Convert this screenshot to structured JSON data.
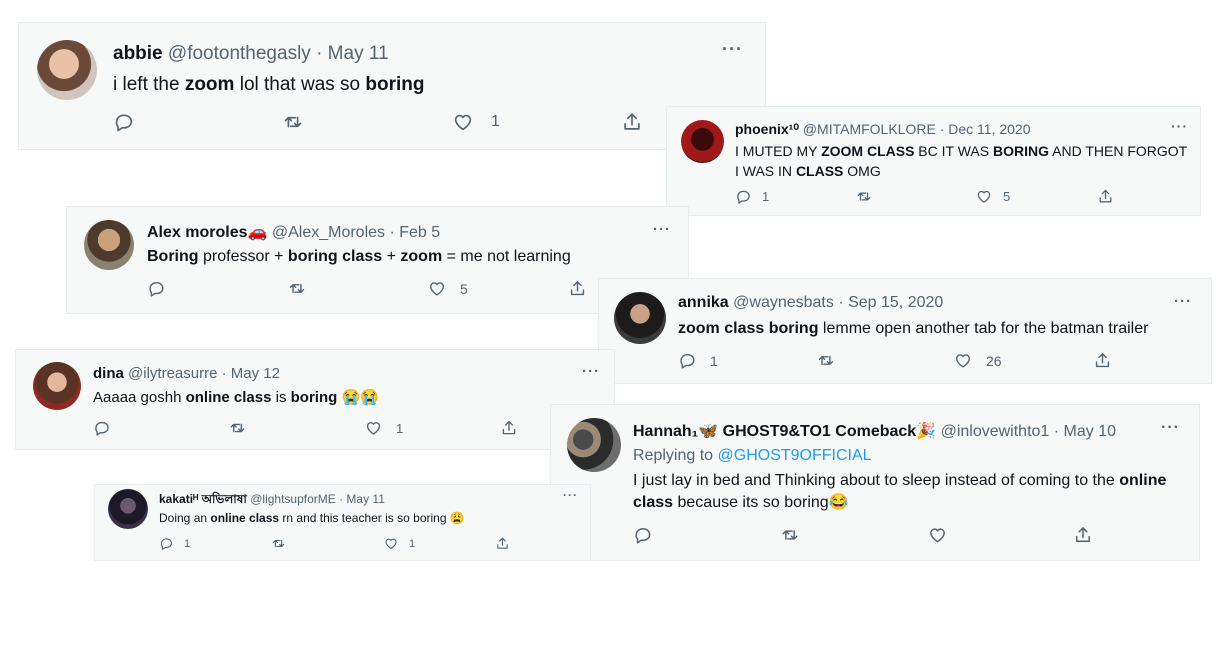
{
  "tweets": {
    "abbie": {
      "name": "abbie",
      "handle": "@footonthegasly · May 11",
      "parts": [
        "i left the ",
        "zoom",
        " lol that was so ",
        "boring"
      ],
      "likes": "1"
    },
    "phoenix": {
      "name": "phoenix¹⁰",
      "handle": "@MITAMFOLKLORE · Dec 11, 2020",
      "parts": [
        "I MUTED MY ",
        "ZOOM CLASS",
        " BC IT WAS ",
        "BORING",
        " AND THEN FORGOT I WAS IN ",
        "CLASS",
        " OMG"
      ],
      "replies": "1",
      "likes": "5"
    },
    "alex": {
      "name": "Alex moroles🚗",
      "handle": "@Alex_Moroles · Feb 5",
      "parts": [
        "Boring",
        " professor + ",
        "boring class",
        " + ",
        "zoom",
        " = me not learning"
      ],
      "likes": "5"
    },
    "annika": {
      "name": "annika",
      "handle": "@waynesbats · Sep 15, 2020",
      "parts": [
        "zoom class boring",
        " lemme open another tab for the batman trailer"
      ],
      "replies": "1",
      "likes": "26"
    },
    "dina": {
      "name": "dina",
      "handle": "@ilytreasurre · May 12",
      "parts": [
        "Aaaaa goshh ",
        "online class",
        " is ",
        "boring",
        " 😭😭"
      ],
      "likes": "1"
    },
    "hannah": {
      "name": "Hannah₁🦋 GHOST9&TO1 Comeback🎉",
      "handle": "@inlovewithto1 · May 10",
      "replying": "Replying to",
      "replying_to": "@GHOST9OFFICIAL",
      "parts": [
        "I just lay in bed and Thinking about to sleep instead of coming to the ",
        "online class",
        " because its so boring😂"
      ]
    },
    "kakati": {
      "name": "kakatiᴴ অভিলাষা",
      "handle": "@lightsupforME · May 11",
      "parts": [
        "Doing an ",
        "online class",
        " rn and this teacher is so boring 😩"
      ],
      "replies": "1",
      "likes": "1"
    }
  },
  "more_label": "···",
  "icons": [
    "reply-icon",
    "retweet-icon",
    "like-icon",
    "share-icon",
    "more-icon"
  ],
  "colors": {
    "card_bg": "#f7f9f9",
    "link": "#1d9bf0",
    "muted": "#536471"
  }
}
